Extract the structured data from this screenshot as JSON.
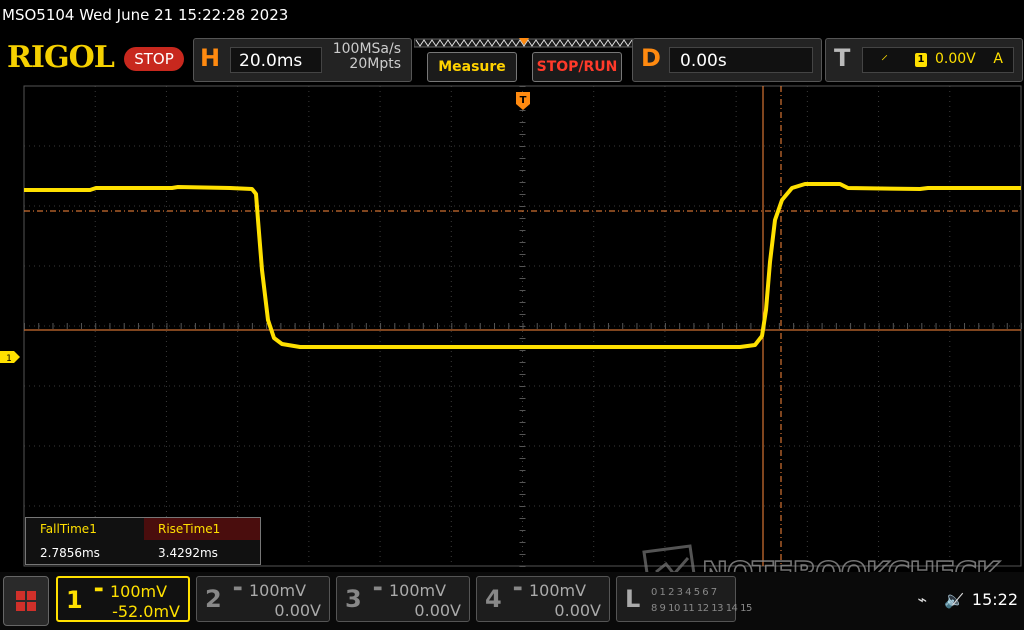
{
  "title": "MSO5104  Wed June 21 15:22:28 2023",
  "brand": "RIGOL",
  "run_state": "STOP",
  "horizontal": {
    "letter": "H",
    "timebase": "20.0ms",
    "sample_rate": "100MSa/s",
    "memory_depth": "20Mpts"
  },
  "buttons": {
    "measure": "Measure",
    "stop_run": "STOP/RUN"
  },
  "delay": {
    "letter": "D",
    "value": "0.00s"
  },
  "trigger": {
    "letter": "T",
    "source": "1",
    "level": "0.00V",
    "mode": "A"
  },
  "channel1_marker": "1",
  "measurements": [
    {
      "name": "FallTime1",
      "value": "2.7856ms"
    },
    {
      "name": "RiseTime1",
      "value": "3.4292ms"
    }
  ],
  "channels": [
    {
      "num": "1",
      "scale": "100mV",
      "offset": "-52.0mV",
      "color": "#ffe000",
      "active": true
    },
    {
      "num": "2",
      "scale": "100mV",
      "offset": "0.00V",
      "color": "#888888",
      "active": false
    },
    {
      "num": "3",
      "scale": "100mV",
      "offset": "0.00V",
      "color": "#888888",
      "active": false
    },
    {
      "num": "4",
      "scale": "100mV",
      "offset": "0.00V",
      "color": "#888888",
      "active": false
    }
  ],
  "logic_analyzer": {
    "letter": "L",
    "row1": "0 1 2 3 4 5 6 7",
    "row2": "8 9 10 11 12 13 14 15"
  },
  "watermark": "NOTEBOOKCHECK",
  "clock": "15:22",
  "colors": {
    "trace": "#ffe000",
    "accent": "#ff8a10",
    "stop": "#c8281e",
    "cursor": "#ff8a3c"
  }
}
